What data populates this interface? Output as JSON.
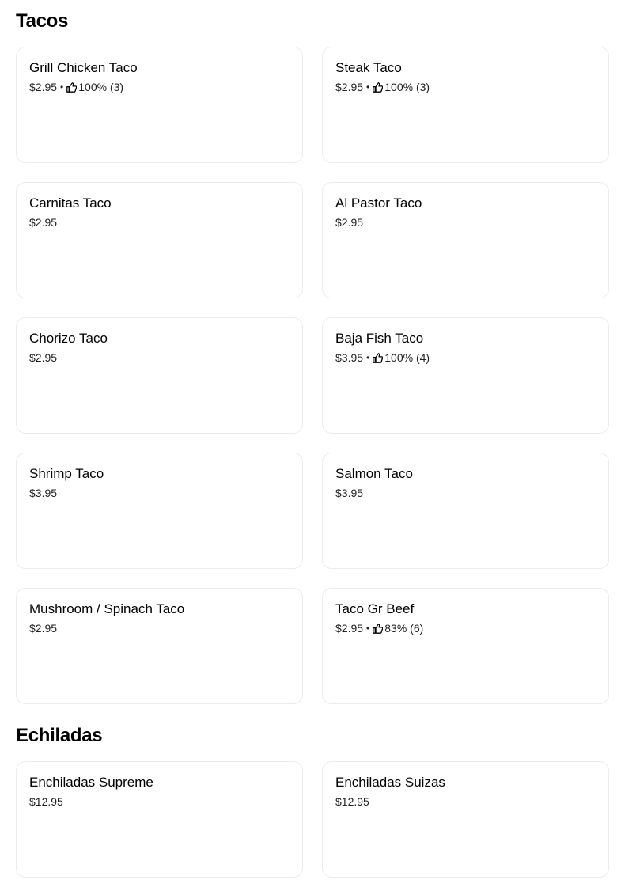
{
  "sections": [
    {
      "title": "Tacos",
      "items": [
        {
          "name": "Grill Chicken Taco",
          "price": "$2.95",
          "rating": "100% (3)"
        },
        {
          "name": "Steak Taco",
          "price": "$2.95",
          "rating": "100% (3)"
        },
        {
          "name": "Carnitas Taco",
          "price": "$2.95",
          "rating": ""
        },
        {
          "name": "Al Pastor Taco",
          "price": "$2.95",
          "rating": ""
        },
        {
          "name": "Chorizo Taco",
          "price": "$2.95",
          "rating": ""
        },
        {
          "name": "Baja Fish Taco",
          "price": "$3.95",
          "rating": "100% (4)"
        },
        {
          "name": "Shrimp Taco",
          "price": "$3.95",
          "rating": ""
        },
        {
          "name": "Salmon Taco",
          "price": "$3.95",
          "rating": ""
        },
        {
          "name": "Mushroom / Spinach Taco",
          "price": "$2.95",
          "rating": ""
        },
        {
          "name": "Taco Gr Beef",
          "price": "$2.95",
          "rating": "83% (6)"
        }
      ]
    },
    {
      "title": "Echiladas",
      "items": [
        {
          "name": "Enchiladas Supreme",
          "price": "$12.95",
          "rating": ""
        },
        {
          "name": "Enchiladas Suizas",
          "price": "$12.95",
          "rating": ""
        }
      ]
    }
  ],
  "icons": {
    "rating": "thumbs-up-icon"
  },
  "separator": "•"
}
